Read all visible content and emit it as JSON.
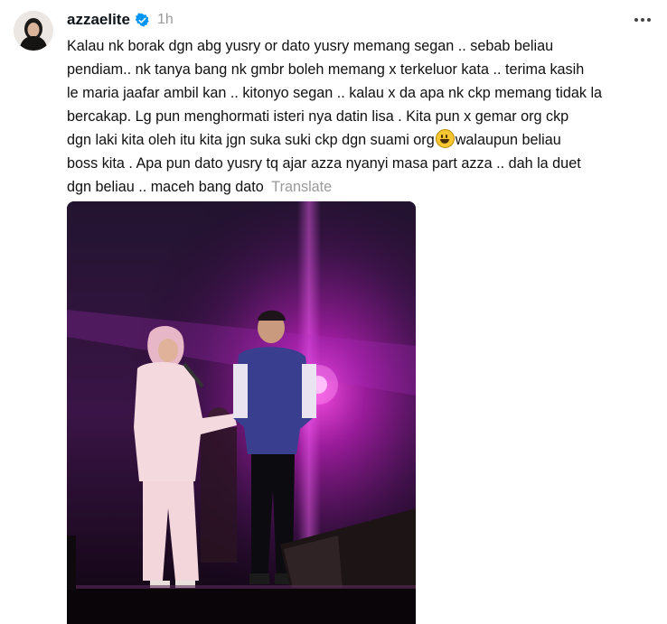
{
  "post": {
    "username": "azzaelite",
    "timestamp": "1h",
    "text_before_emoji": "Kalau nk borak dgn abg yusry or dato yusry memang segan .. sebab beliau\npendiam.. nk tanya bang nk gmbr boleh memang x terkeluor kata .. terima kasih\nle maria jaafar ambil kan .. kitonyo segan .. kalau x da apa nk ckp memang tidak la\nbercakap. Lg pun menghormati isteri nya datin lisa . Kita pun x gemar org ckp\ndgn laki kita oleh itu kita jgn suka suki ckp dgn suami org",
    "text_after_emoji": "walaupun beliau\nboss kita . Apa pun dato yusry tq ajar azza nyanyi masa part azza .. dah la duet\ndgn beliau .. maceh bang dato",
    "translate_label": "Translate",
    "emoji_name": "grinning-face-emoji",
    "icons": {
      "verified": "verified-badge-icon",
      "more": "more-options-icon"
    },
    "colors": {
      "verified": "#0095f6",
      "muted": "#9a9a9a"
    }
  }
}
